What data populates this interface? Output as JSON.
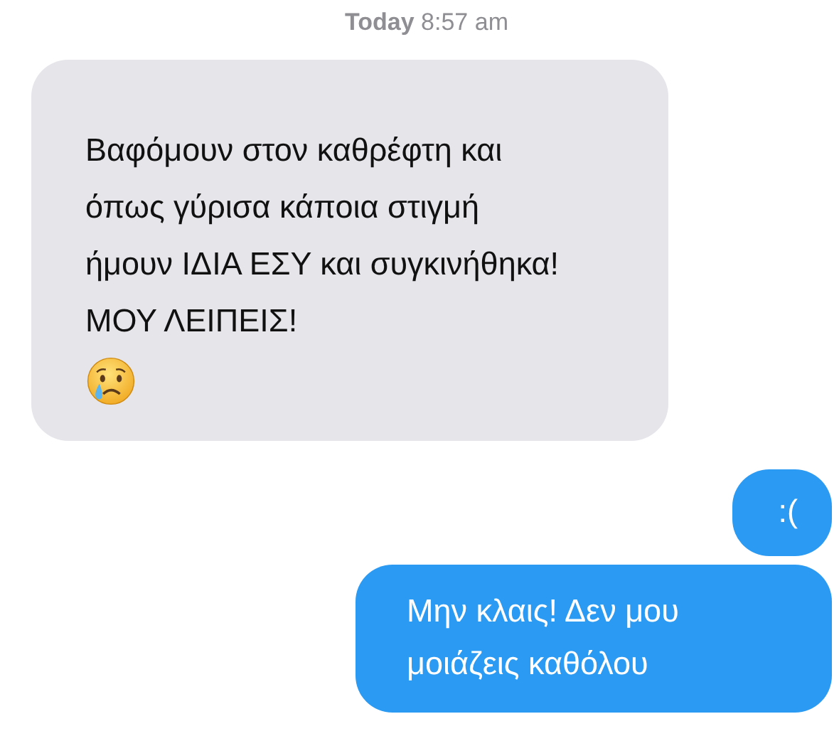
{
  "timestamp": {
    "day": "Today",
    "time": "8:57 am"
  },
  "messages": [
    {
      "kind": "received",
      "text": "Βαφόμουν στον καθρέφτη και\nόπως γύρισα κάποια στιγμή\nήμουν ΙΔΙΑ ΕΣΥ και συγκινήθηκα!\nΜΟΥ ΛΕΙΠΕΙΣ!",
      "attachments": [
        {
          "kind": "crying-face"
        }
      ]
    },
    {
      "kind": "sent",
      "text": ":("
    },
    {
      "kind": "sent",
      "text": "Μην κλαις! Δεν μου\nμοιάζεις καθόλου"
    }
  ]
}
